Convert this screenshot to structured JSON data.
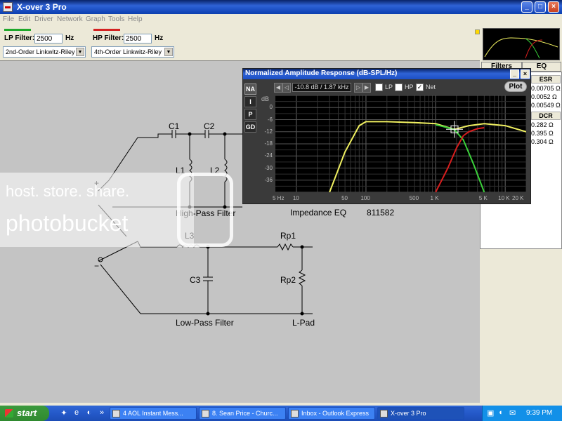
{
  "window": {
    "title": "X-over 3 Pro",
    "min": "_",
    "max": "□",
    "close": "×"
  },
  "menu": [
    "File",
    "Edit",
    "Driver",
    "Network",
    "Graph",
    "Tools",
    "Help"
  ],
  "controls": {
    "lp_label": "LP Filter:",
    "lp_value": "2500",
    "lp_unit": "Hz",
    "lp_type": "2nd-Order Linkwitz-Riley",
    "lp_color": "#1ea82a",
    "hp_label": "HP Filter:",
    "hp_value": "2500",
    "hp_unit": "Hz",
    "hp_type": "4th-Order Linkwitz-Riley",
    "hp_color": "#d42222"
  },
  "schematic": {
    "c1": "C1",
    "c2": "C2",
    "l1": "L1",
    "l2": "L2",
    "l3": "L3",
    "c3": "C3",
    "rp1": "Rp1",
    "rp2": "Rp2",
    "plus": "+",
    "minus": "−",
    "high_pass": "High-Pass Filter",
    "low_pass": "Low-Pass Filter",
    "lpad": "L-Pad",
    "impedance_eq": "Impedance EQ",
    "part_number": "811582"
  },
  "right_panel": {
    "tabs": [
      "Filters",
      "EQ"
    ],
    "esr_header": "ESR",
    "esr_values": [
      "0.00705 Ω",
      "0.0052 Ω",
      "0.00549 Ω"
    ],
    "dcr_header": "DCR",
    "dcr_values": [
      "0.282 Ω",
      "0.395 Ω",
      "0.304 Ω"
    ]
  },
  "amp_window": {
    "title": "Normalized Amplitude Response (dB-SPL/Hz)",
    "side_buttons": [
      "NA",
      "I",
      "P",
      "GD"
    ],
    "readout": "-10.8 dB / 1.87 kHz",
    "checkboxes": [
      {
        "label": "LP",
        "checked": false
      },
      {
        "label": "HP",
        "checked": false
      },
      {
        "label": "Net",
        "checked": true
      }
    ],
    "plot_button": "Plot",
    "y_unit": "dB"
  },
  "chart_data": {
    "type": "line",
    "ylabel": "dB",
    "xlabel": "",
    "x_scale": "log",
    "xlim": [
      5,
      20000
    ],
    "ylim": [
      -42,
      6
    ],
    "grid": true,
    "x_ticks": [
      "5 Hz",
      "10",
      "50",
      "100",
      "500",
      "1 K",
      "5 K",
      "10 K",
      "20 K"
    ],
    "y_ticks": [
      "0",
      "-6",
      "-12",
      "-18",
      "-24",
      "-30",
      "-36"
    ],
    "series": [
      {
        "color": "#f0f060",
        "x": [
          30,
          50,
          80,
          100,
          200,
          500,
          1000,
          1870,
          3000,
          5000,
          10000,
          20000
        ],
        "y": [
          -42,
          -22,
          -9,
          -7,
          -7,
          -7.5,
          -8,
          -10.8,
          -9,
          -8,
          -9,
          -12
        ]
      },
      {
        "color": "#3ad23a",
        "x": [
          1000,
          1500,
          1870,
          2500,
          3500,
          5000
        ],
        "y": [
          -8.5,
          -10,
          -11,
          -16,
          -28,
          -42
        ]
      },
      {
        "color": "#d81e1e",
        "x": [
          1000,
          1500,
          2000,
          2500,
          3000,
          4000,
          5000
        ],
        "y": [
          -42,
          -30,
          -20,
          -14,
          -12,
          -10.5,
          -10
        ]
      }
    ],
    "cursor": {
      "x": 1870,
      "y": -10.8
    }
  },
  "watermark": {
    "line1": "host. store. share.",
    "line2": "photobucket"
  },
  "taskbar": {
    "start": "start",
    "items": [
      "4 AOL Instant Mess...",
      "8. Sean Price - Churc...",
      "Inbox - Outlook Express",
      "X-over 3 Pro"
    ],
    "clock": "9:39 PM"
  }
}
